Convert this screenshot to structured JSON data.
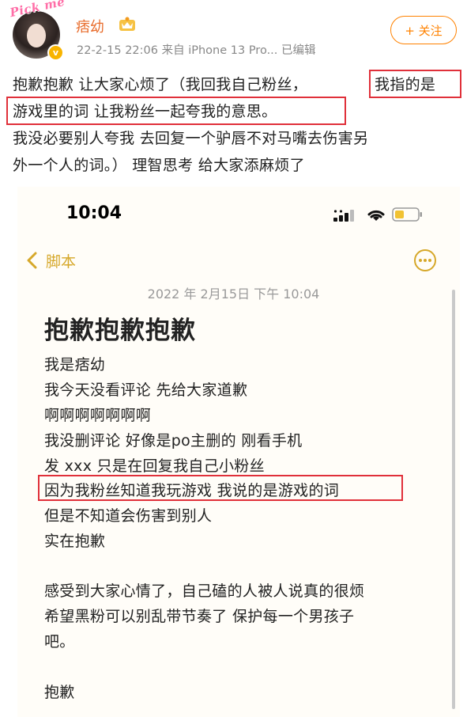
{
  "post": {
    "badge_text": "Pick me",
    "username": "痞幼",
    "meta": "22-2-15 22:06  来自 iPhone 13 Pro...  已编辑",
    "follow_label": "+ 关注",
    "lines": [
      "抱歉抱歉 让大家心烦了（我回我自己粉丝，",
      "我指的是",
      "游戏里的词 让我粉丝一起夸我的意思。",
      " 我没必要别人夸我 去回复一个驴唇不对马嘴去伤害另",
      "外一个人的词。）  理智思考 给大家添麻烦了"
    ]
  },
  "screenshot": {
    "time": "10:04",
    "back_label": "脚本",
    "date": "2022 年 2月15日 下午 10:04",
    "title": "抱歉抱歉抱歉",
    "lines": [
      "我是痞幼",
      "我今天没看评论 先给大家道歉",
      "啊啊啊啊啊啊啊",
      "我没删评论 好像是po主删的 刚看手机",
      "发 xxx 只是在回复我自己小粉丝",
      "因为我粉丝知道我玩游戏 我说的是游戏的词",
      "但是不知道会伤害到别人",
      "实在抱歉",
      "感受到大家心情了，自己磕的人被人说真的很烦",
      "希望黑粉可以别乱带节奏了  保护每一个男孩子",
      "吧。",
      "抱歉"
    ]
  },
  "colors": {
    "username": "#e86b2a",
    "follow": "#ff8200",
    "highlight_box": "#e0303a",
    "notes_accent": "#d6a82a"
  },
  "icons": [
    "verified-badge-icon",
    "vip-crown-icon",
    "signal-icon",
    "wifi-icon",
    "battery-icon",
    "back-chevron-icon",
    "more-options-icon"
  ]
}
